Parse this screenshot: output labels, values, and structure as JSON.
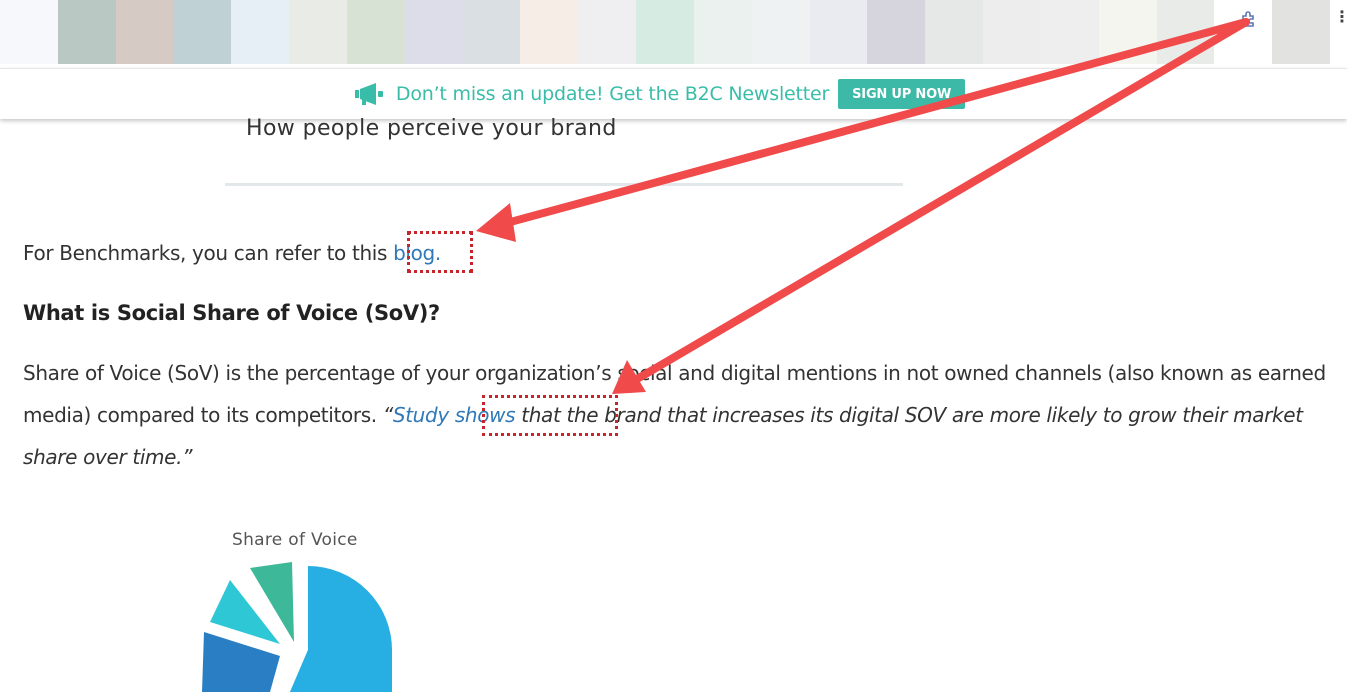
{
  "browser": {
    "swatch_colors": [
      "#f6f8fb",
      "#b9c8c2",
      "#d5cbc4",
      "#c0d1d6",
      "#e6eff6",
      "#e9ebe6",
      "#d8e2d4",
      "#dcdde8",
      "#d9dfe2",
      "#f6eee6",
      "#efeef0",
      "#d6ece3",
      "#eaf1ef",
      "#eef2f3",
      "#e9ebf0",
      "#d6d5de",
      "#e6e8e8",
      "#ededed",
      "#eeeeee",
      "#f5f5f0",
      "#e9ebe9",
      "#ffffff",
      "#e2e2e0"
    ],
    "extension_icon": "puzzle-extension-icon",
    "menu_icon": "vertical-dots-menu-icon",
    "menu_glyph": "⋮"
  },
  "banner": {
    "icon": "megaphone-icon",
    "text": "Don’t miss an update! Get the B2C Newsletter",
    "button_label": "SIGN UP NOW",
    "text_color": "#39bda8",
    "button_color": "#3cb9a7"
  },
  "article": {
    "image_caption": "How people perceive your brand",
    "benchmark_text": "For Benchmarks, you can refer to this ",
    "benchmark_link": "blog.",
    "heading": "What is Social Share of Voice (SoV)?",
    "sov_text": "Share of Voice (SoV) is the percentage of your organization’s social and digital mentions in not owned channels (also known as earned media) compared to its competitors. ",
    "quote_open": "“",
    "study_link": "Study shows",
    "quote_rest": " that the brand that increases its digital SOV are more likely to grow their market share over time.”",
    "link_color": "#2f79b8",
    "highlight_color": "#c6262b"
  },
  "pie_chart": {
    "title": "Share of Voice",
    "colors": [
      "#27aee3",
      "#2a7fc4",
      "#2ec7d5",
      "#3db99a"
    ]
  },
  "annotation": {
    "arrow_color": "#f04a4a"
  }
}
